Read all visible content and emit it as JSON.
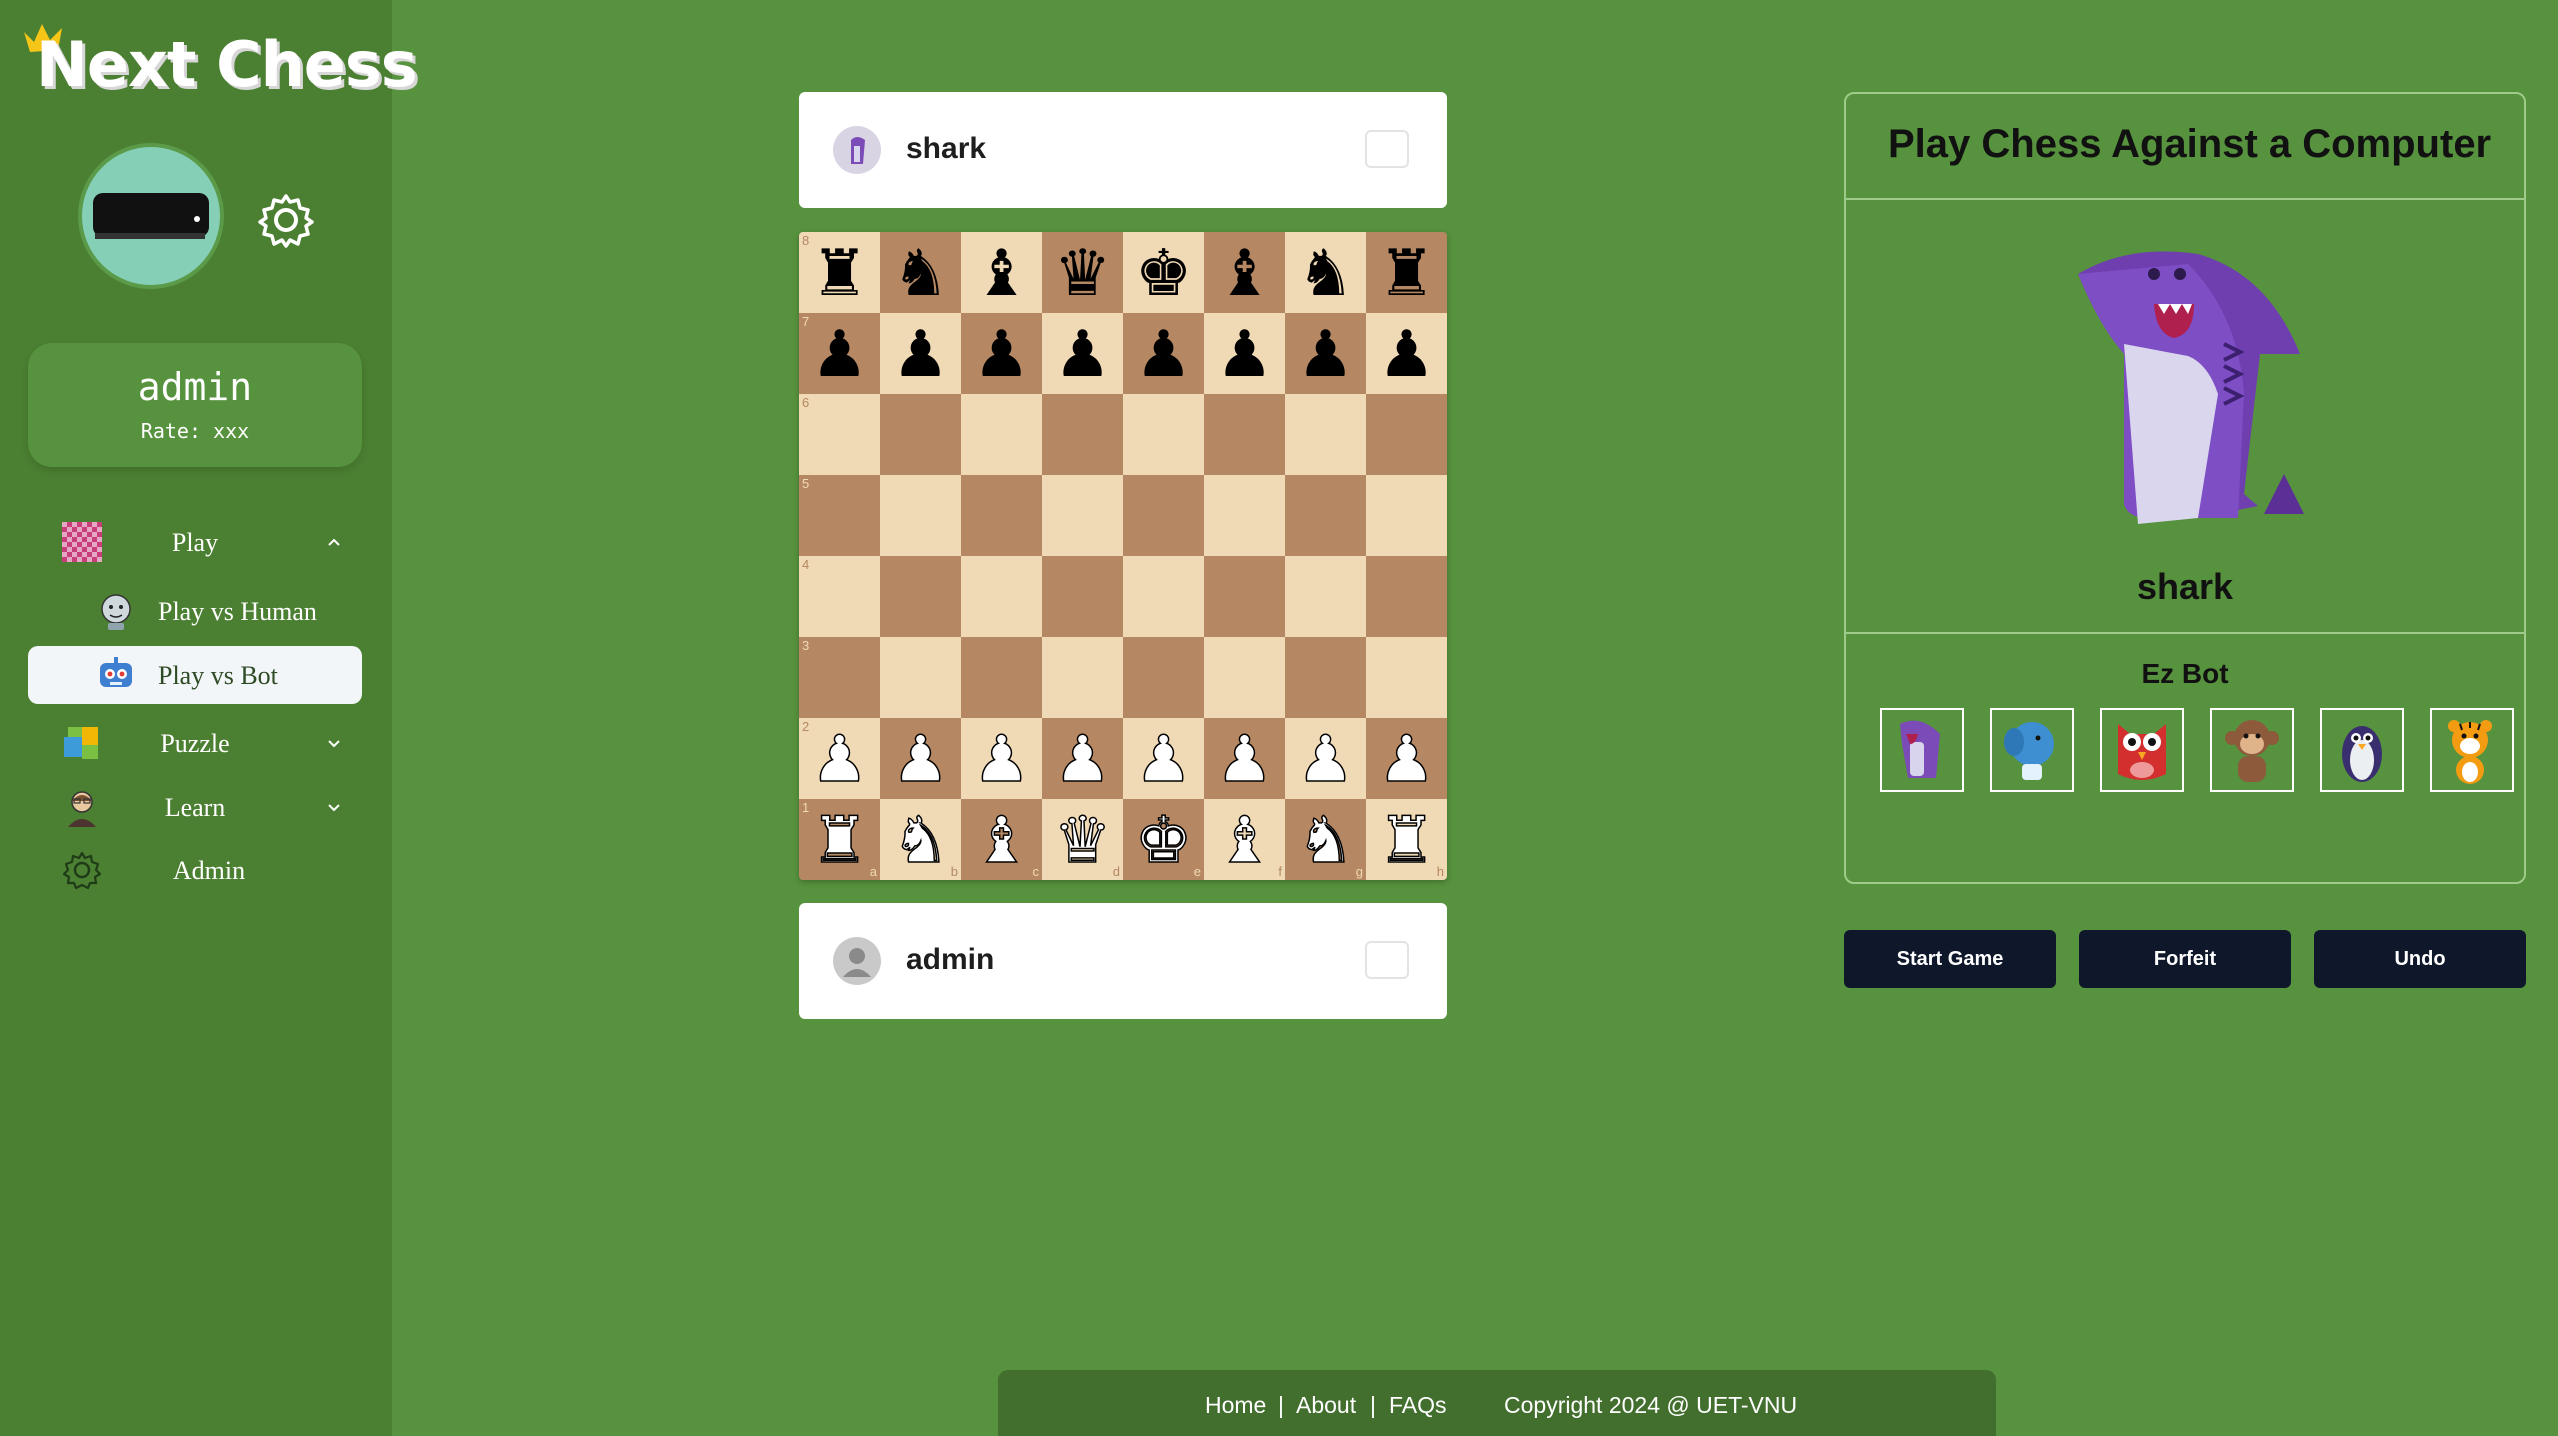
{
  "app": {
    "logo_text": "Next Chess"
  },
  "user": {
    "name": "admin",
    "rate": "Rate: xxx"
  },
  "nav": {
    "play": "Play",
    "play_vs_human": "Play vs Human",
    "play_vs_bot": "Play vs Bot",
    "puzzle": "Puzzle",
    "learn": "Learn",
    "admin": "Admin"
  },
  "players": {
    "top": {
      "name": "shark"
    },
    "bottom": {
      "name": "admin"
    }
  },
  "board": {
    "rank_labels": [
      "8",
      "7",
      "6",
      "5",
      "4",
      "3",
      "2",
      "1"
    ],
    "file_labels": [
      "a",
      "b",
      "c",
      "d",
      "e",
      "f",
      "g",
      "h"
    ],
    "position": [
      [
        "r",
        "n",
        "b",
        "q",
        "k",
        "b",
        "n",
        "r"
      ],
      [
        "p",
        "p",
        "p",
        "p",
        "p",
        "p",
        "p",
        "p"
      ],
      [
        "",
        "",
        "",
        "",
        "",
        "",
        "",
        ""
      ],
      [
        "",
        "",
        "",
        "",
        "",
        "",
        "",
        ""
      ],
      [
        "",
        "",
        "",
        "",
        "",
        "",
        "",
        ""
      ],
      [
        "",
        "",
        "",
        "",
        "",
        "",
        "",
        ""
      ],
      [
        "P",
        "P",
        "P",
        "P",
        "P",
        "P",
        "P",
        "P"
      ],
      [
        "R",
        "N",
        "B",
        "Q",
        "K",
        "B",
        "N",
        "R"
      ]
    ],
    "light_color": "#f0d9b5",
    "dark_color": "#b58863"
  },
  "panel": {
    "title": "Play Chess Against a Computer",
    "selected_bot": "shark",
    "level": "Ez Bot",
    "bots": [
      "shark",
      "elephant",
      "owl",
      "monkey",
      "penguin",
      "tiger"
    ]
  },
  "actions": {
    "start": "Start Game",
    "forfeit": "Forfeit",
    "undo": "Undo"
  },
  "footer": {
    "home": "Home",
    "about": "About",
    "faqs": "FAQs",
    "sep": "|",
    "copyright": "Copyright 2024 @ UET-VNU"
  },
  "colors": {
    "background": "#57923e",
    "sidebar": "#4b7f31",
    "button": "#0f172a"
  }
}
